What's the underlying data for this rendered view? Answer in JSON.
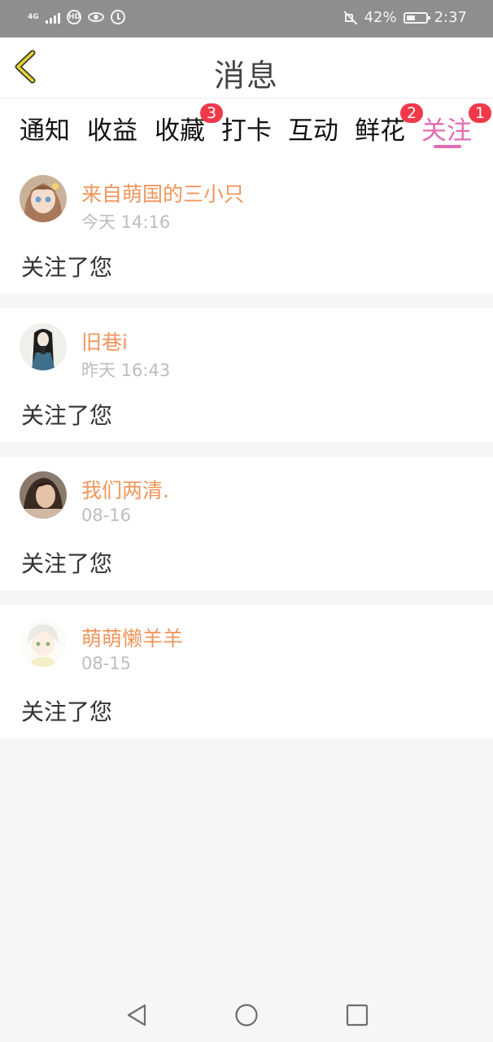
{
  "status_bar": {
    "network": "4G",
    "hd_label": "HD",
    "battery_percent": "42%",
    "time": "2:37"
  },
  "header": {
    "title": "消息"
  },
  "tabs": [
    {
      "label": "通知",
      "badge": ""
    },
    {
      "label": "收益",
      "badge": ""
    },
    {
      "label": "收藏",
      "badge": "3"
    },
    {
      "label": "打卡",
      "badge": ""
    },
    {
      "label": "互动",
      "badge": ""
    },
    {
      "label": "鲜花",
      "badge": "2"
    },
    {
      "label": "关注",
      "badge": "1",
      "active": true
    }
  ],
  "messages": [
    {
      "username": "来自萌国的三小只",
      "time": "今天 14:16",
      "action": "关注了您"
    },
    {
      "username": "旧巷i",
      "time": "昨天 16:43",
      "action": "关注了您"
    },
    {
      "username": "我们两清.",
      "time": "08-16",
      "action": "关注了您"
    },
    {
      "username": "萌萌懒羊羊",
      "time": "08-15",
      "action": "关注了您"
    }
  ],
  "colors": {
    "accent": "#e46bb0",
    "username": "#f0965c",
    "badge": "#f0394a",
    "status_bar": "#8e8e8e"
  },
  "icons": {
    "back": "chevron-left-icon",
    "nav_back": "triangle-back-icon",
    "nav_home": "circle-home-icon",
    "nav_recent": "square-recent-icon"
  }
}
